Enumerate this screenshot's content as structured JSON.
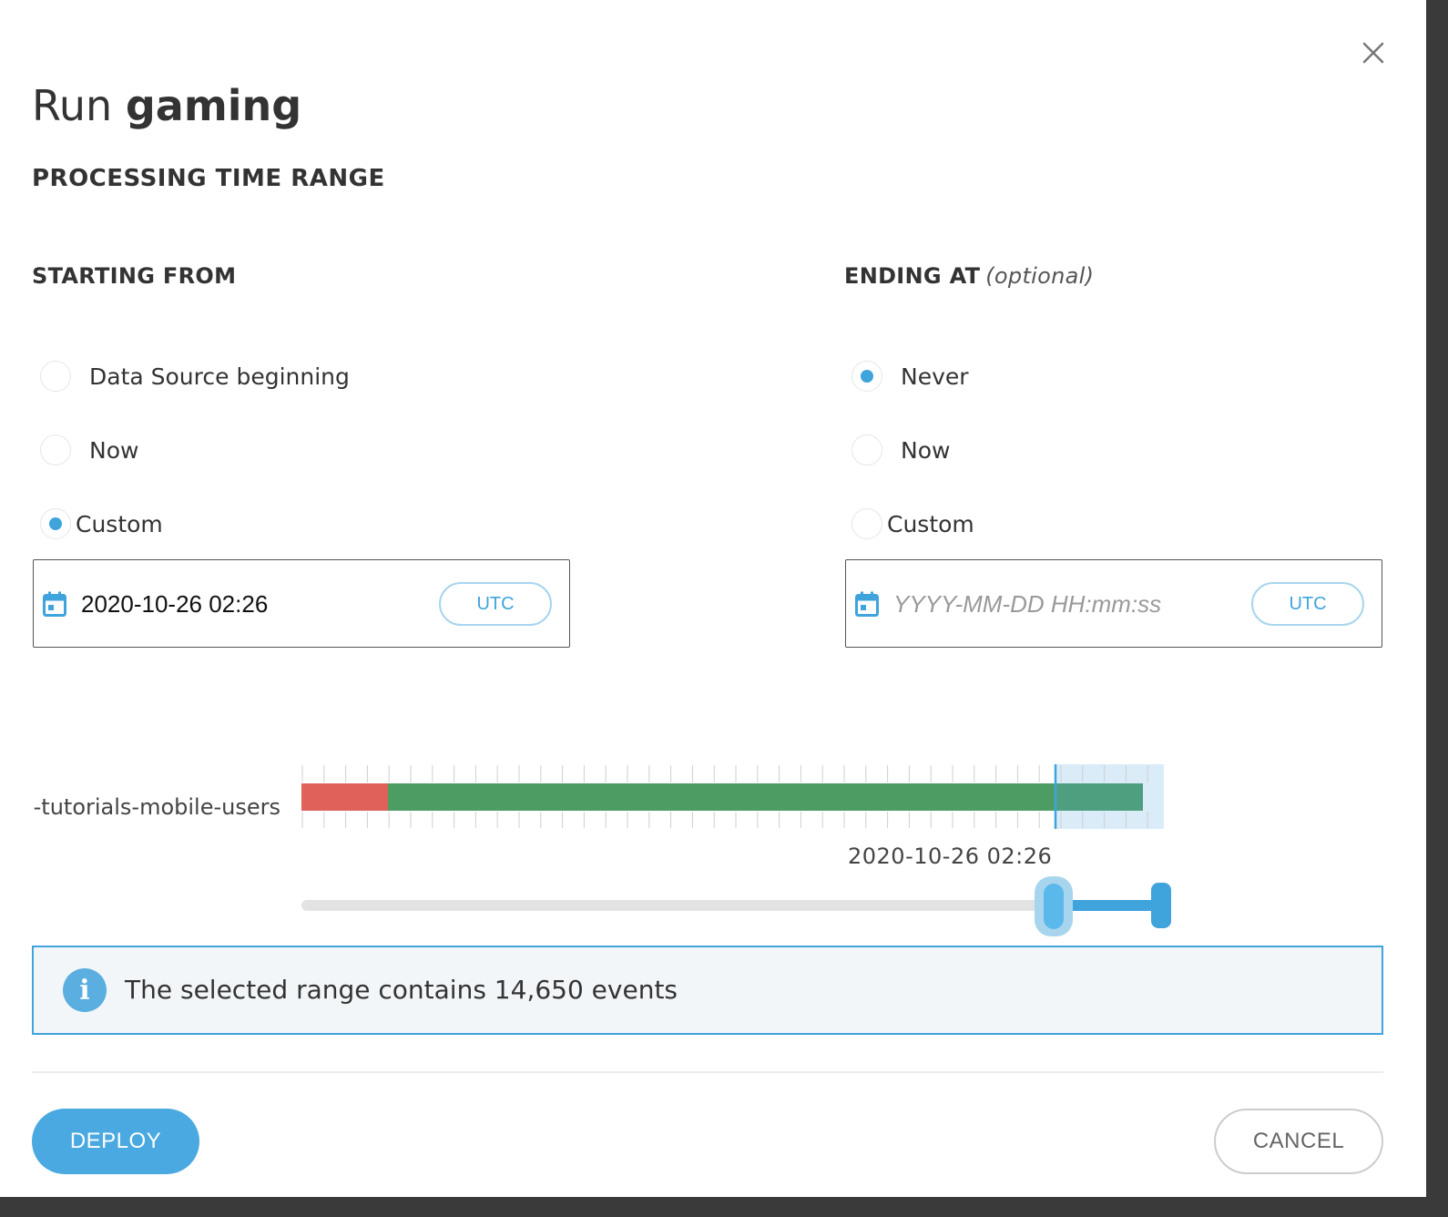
{
  "dialog": {
    "title_prefix": "Run",
    "title_name": "gaming",
    "section_heading": "PROCESSING TIME RANGE",
    "close_icon": "close-icon"
  },
  "starting_from": {
    "heading": "STARTING FROM",
    "options": [
      {
        "label": "Data Source beginning",
        "selected": false
      },
      {
        "label": "Now",
        "selected": false
      },
      {
        "label": "Custom",
        "selected": true
      }
    ],
    "date_value": "2020-10-26 02:26",
    "timezone_label": "UTC",
    "calendar_icon": "calendar-icon"
  },
  "ending_at": {
    "heading": "ENDING AT",
    "heading_note": "(optional)",
    "options": [
      {
        "label": "Never",
        "selected": true
      },
      {
        "label": "Now",
        "selected": false
      },
      {
        "label": "Custom",
        "selected": false
      }
    ],
    "date_placeholder": "YYYY-MM-DD HH:mm:ss",
    "timezone_label": "UTC",
    "calendar_icon": "calendar-icon"
  },
  "timeline": {
    "source_name": "-tutorials-mobile-users",
    "slider_start_label": "2020-10-26 02:26",
    "colors": {
      "missing": "#e0605a",
      "available": "#4d9c63",
      "selected_overlay": "#daecf8",
      "accent": "#3fa3dc"
    }
  },
  "info": {
    "icon": "info-icon",
    "message": "The selected range contains 14,650 events"
  },
  "actions": {
    "deploy_label": "DEPLOY",
    "cancel_label": "CANCEL"
  },
  "colors": {
    "accent": "#3fa3dc",
    "text": "#333333"
  }
}
